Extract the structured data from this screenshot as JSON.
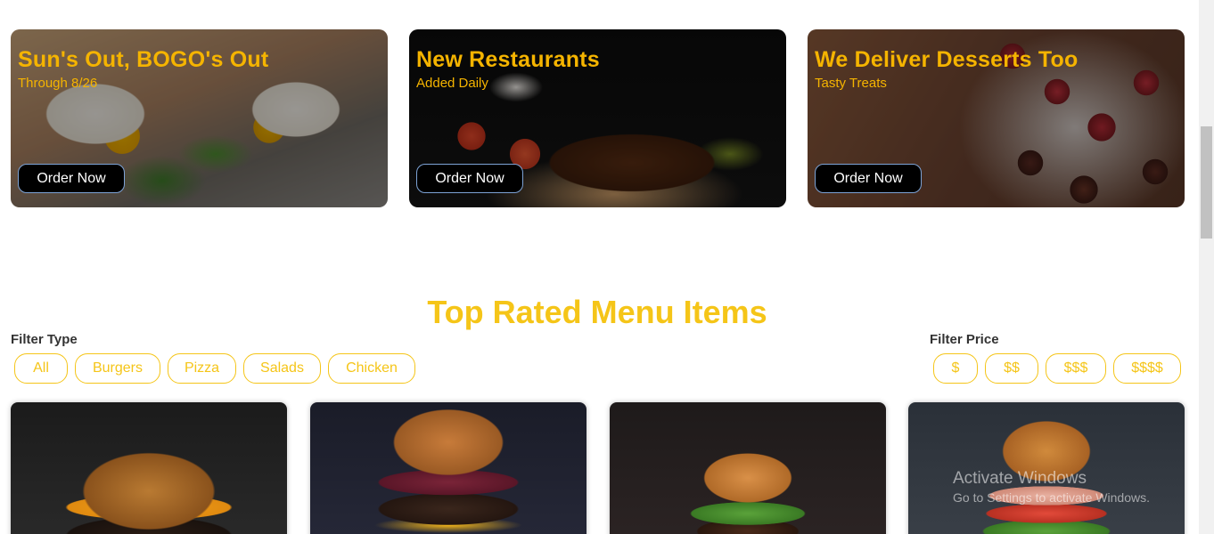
{
  "promos": [
    {
      "title": "Sun's Out, BOGO's Out",
      "subtitle": "Through 8/26",
      "button": "Order Now"
    },
    {
      "title": "New Restaurants",
      "subtitle": "Added Daily",
      "button": "Order Now"
    },
    {
      "title": "We Deliver Desserts Too",
      "subtitle": "Tasty Treats",
      "button": "Order Now"
    }
  ],
  "section": {
    "title": "Top Rated Menu Items"
  },
  "filters": {
    "type_label": "Filter Type",
    "type_options": [
      "All",
      "Burgers",
      "Pizza",
      "Salads",
      "Chicken"
    ],
    "price_label": "Filter Price",
    "price_options": [
      "$",
      "$$",
      "$$$",
      "$$$$"
    ]
  },
  "watermark": {
    "line1": "Activate Windows",
    "line2": "Go to Settings to activate Windows."
  },
  "colors": {
    "accent": "#f5c518",
    "button_bg": "#000000",
    "button_border": "#7da3d6"
  }
}
